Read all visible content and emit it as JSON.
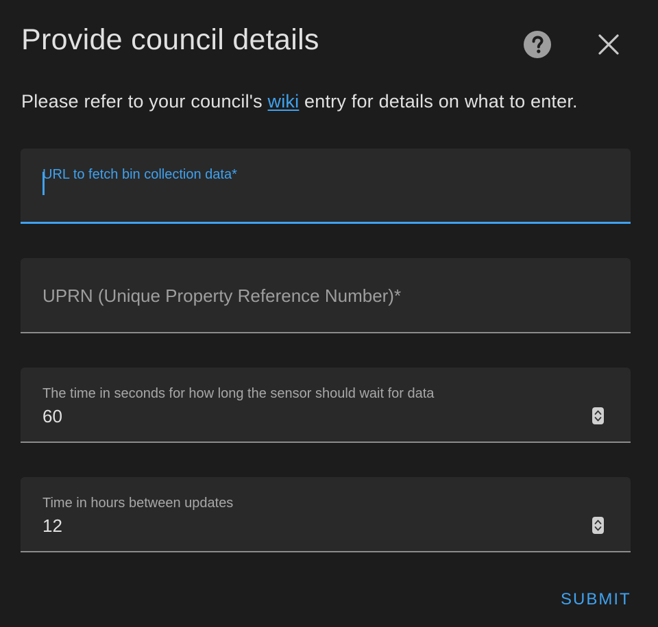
{
  "dialog": {
    "title": "Provide council details",
    "description_before": "Please refer to your council's ",
    "description_link": "wiki",
    "description_after": " entry for details on what to enter."
  },
  "fields": [
    {
      "label": "URL to fetch bin collection data*",
      "value": "",
      "state": "focused"
    },
    {
      "label": "UPRN (Unique Property Reference Number)*",
      "value": "",
      "state": "empty"
    },
    {
      "label": "The time in seconds for how long the sensor should wait for data",
      "value": "60",
      "state": "filled"
    },
    {
      "label": "Time in hours between updates",
      "value": "12",
      "state": "filled"
    }
  ],
  "actions": {
    "submit_label": "SUBMIT"
  },
  "icons": {
    "help": "help-circle-icon",
    "close": "close-icon"
  },
  "colors": {
    "background": "#1c1c1c",
    "field_background": "#292929",
    "accent": "#3fa2f0",
    "text": "#e1e1e1",
    "muted_text": "#a8a8a8"
  }
}
